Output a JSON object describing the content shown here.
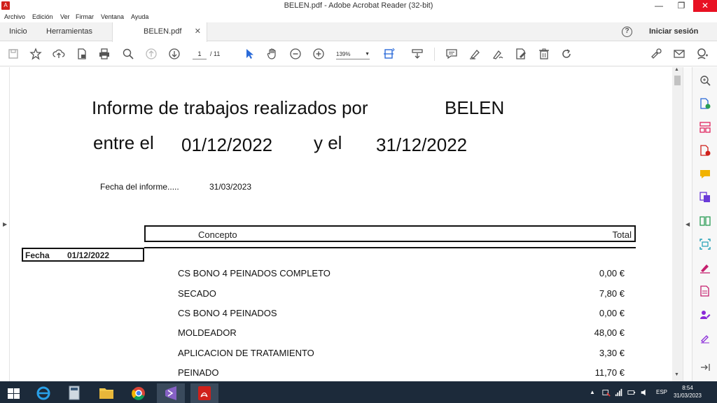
{
  "window": {
    "title": "BELEN.pdf - Adobe Acrobat Reader (32-bit)",
    "minimize": "—",
    "restore": "❐",
    "close": "✕"
  },
  "menu": [
    "Archivo",
    "Edición",
    "Ver",
    "Firmar",
    "Ventana",
    "Ayuda"
  ],
  "tabs": {
    "home": "Inicio",
    "tools": "Herramientas",
    "doc": "BELEN.pdf",
    "doc_close": "✕",
    "help": "?",
    "signin": "Iniciar sesión"
  },
  "toolbar": {
    "page_current": "1",
    "page_total": "/ 11",
    "zoom": "139%"
  },
  "document": {
    "title_line": "Informe de trabajos realizados por",
    "name": "BELEN",
    "between": "entre el",
    "date_from": "01/12/2022",
    "and": "y el",
    "date_to": "31/12/2022",
    "report_date_label": "Fecha del informe.....",
    "report_date": "31/03/2023",
    "col_concept": "Concepto",
    "col_total": "Total",
    "fecha_label": "Fecha",
    "fecha_value": "01/12/2022",
    "rows": [
      {
        "concept": "CS BONO 4 PEINADOS COMPLETO",
        "total": "0,00 €"
      },
      {
        "concept": "SECADO",
        "total": "7,80 €"
      },
      {
        "concept": "CS BONO 4 PEINADOS",
        "total": "0,00 €"
      },
      {
        "concept": "MOLDEADOR",
        "total": "48,00 €"
      },
      {
        "concept": "APLICACION DE TRATAMIENTO",
        "total": "3,30 €"
      },
      {
        "concept": "PEINADO",
        "total": "11,70 €"
      }
    ]
  },
  "taskbar": {
    "lang": "ESP",
    "time": "8:54",
    "date": "31/03/2023"
  },
  "colors": {
    "acrobat_red": "#d0201a",
    "taskbar": "#1c2a3a",
    "accent_blue": "#2a6ad8"
  }
}
